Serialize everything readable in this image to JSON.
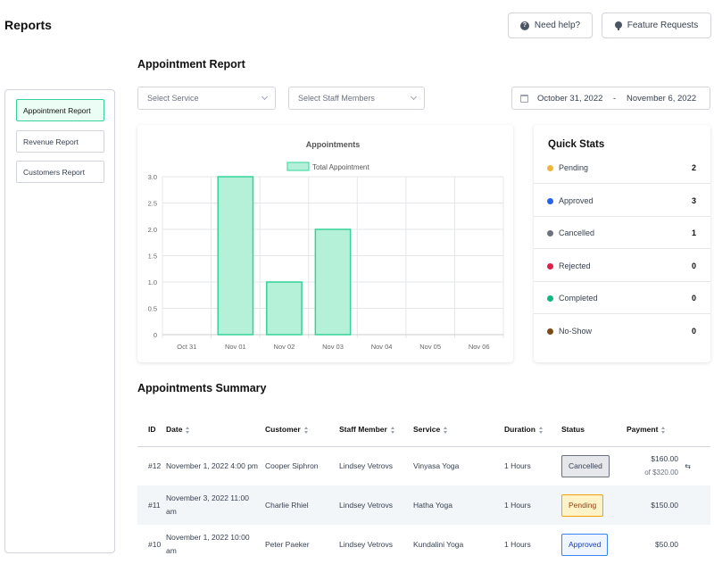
{
  "header": {
    "title": "Reports",
    "help_label": "Need help?",
    "feature_label": "Feature Requests"
  },
  "sidebar": {
    "items": [
      {
        "label": "Appointment Report",
        "active": true
      },
      {
        "label": "Revenue Report",
        "active": false
      },
      {
        "label": "Customers Report",
        "active": false
      }
    ]
  },
  "report": {
    "title": "Appointment Report",
    "service_placeholder": "Select Service",
    "staff_placeholder": "Select Staff Members",
    "date_from": "October 31, 2022",
    "date_separator": "-",
    "date_to": "November 6, 2022"
  },
  "chart_data": {
    "type": "bar",
    "title": "Appointments",
    "categories": [
      "Oct 31",
      "Nov 01",
      "Nov 02",
      "Nov 03",
      "Nov 04",
      "Nov 05",
      "Nov 06"
    ],
    "series": [
      {
        "name": "Total Appointment",
        "values": [
          0,
          3,
          1,
          2,
          0,
          0,
          0
        ]
      }
    ],
    "yticks": [
      "0",
      "0.5",
      "1.0",
      "1.5",
      "2.0",
      "2.5",
      "3.0"
    ],
    "ylim": [
      0,
      3
    ],
    "grid": true,
    "legend": "top-center",
    "colors": {
      "fill": "#b5f0d8",
      "stroke": "#34d399"
    }
  },
  "quick_stats": {
    "title": "Quick Stats",
    "items": [
      {
        "label": "Pending",
        "count": "2",
        "color": "#f0b43c"
      },
      {
        "label": "Approved",
        "count": "3",
        "color": "#2563eb"
      },
      {
        "label": "Cancelled",
        "count": "1",
        "color": "#6b7280"
      },
      {
        "label": "Rejected",
        "count": "0",
        "color": "#e11d48"
      },
      {
        "label": "Completed",
        "count": "0",
        "color": "#10b981"
      },
      {
        "label": "No-Show",
        "count": "0",
        "color": "#7c4a14"
      }
    ]
  },
  "summary": {
    "title": "Appointments Summary",
    "columns": [
      "ID",
      "Date",
      "Customer",
      "Staff Member",
      "Service",
      "Duration",
      "Status",
      "Payment"
    ],
    "rows": [
      {
        "id": "#12",
        "date": "November 1, 2022 4:00 pm",
        "customer": "Cooper Siphron",
        "staff": "Lindsey Vetrovs",
        "service": "Vinyasa Yoga",
        "duration": "1 Hours",
        "status": "Cancelled",
        "payment": "$160.00",
        "payment_sub": "of $320.00"
      },
      {
        "id": "#11",
        "date": "November 3, 2022 11:00 am",
        "customer": "Charlie Rhiel",
        "staff": "Lindsey Vetrovs",
        "service": "Hatha Yoga",
        "duration": "1 Hours",
        "status": "Pending",
        "payment": "$150.00",
        "payment_sub": ""
      },
      {
        "id": "#10",
        "date": "November 1, 2022 10:00 am",
        "customer": "Peter Paeker",
        "staff": "Lindsey Vetrovs",
        "service": "Kundalini Yoga",
        "duration": "1 Hours",
        "status": "Approved",
        "payment": "$50.00",
        "payment_sub": ""
      }
    ]
  }
}
